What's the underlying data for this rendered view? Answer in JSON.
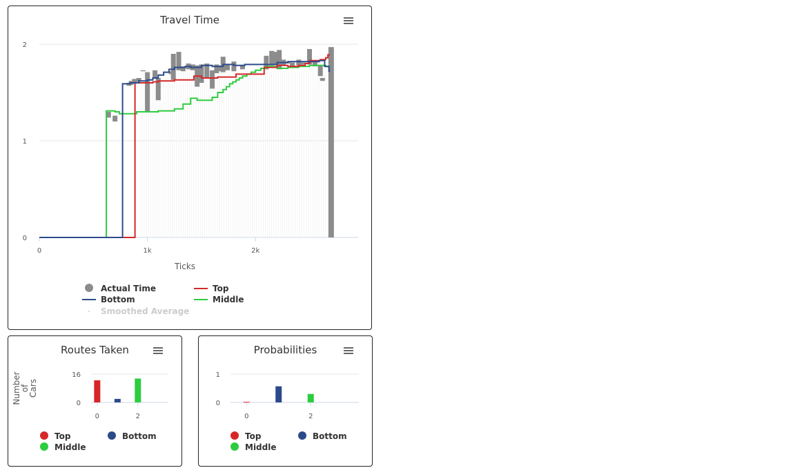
{
  "colors": {
    "top": "#d62728",
    "bottom": "#2c4a8a",
    "middle": "#2ecc40",
    "actual": "#8c8c8c",
    "smoothed": "#cccccc",
    "grid": "#e6e6e6",
    "axis": "#ccd6eb"
  },
  "travel": {
    "title": "Travel Time",
    "menu_icon": "hamburger-menu-icon"
  },
  "routes": {
    "title": "Routes Taken",
    "menu_icon": "hamburger-menu-icon"
  },
  "probs": {
    "title": "Probabilities",
    "menu_icon": "hamburger-menu-icon"
  },
  "chart_data": [
    {
      "type": "line",
      "title": "Travel Time",
      "xlabel": "Ticks",
      "ylabel": "",
      "xlim": [
        0,
        2950
      ],
      "ylim": [
        0,
        2
      ],
      "x_ticks": [
        {
          "value": 0,
          "label": "0"
        },
        {
          "value": 1000,
          "label": "1k"
        },
        {
          "value": 2000,
          "label": "2k"
        }
      ],
      "y_ticks": [
        {
          "value": 0,
          "label": "0"
        },
        {
          "value": 1,
          "label": "1"
        },
        {
          "value": 2,
          "label": "2"
        }
      ],
      "grid": true,
      "legend": {
        "placement": "bottom",
        "items": [
          {
            "name": "Actual Time",
            "symbol": "circle",
            "color_key": "actual",
            "hidden": false
          },
          {
            "name": "Top",
            "symbol": "line",
            "color_key": "top",
            "hidden": false
          },
          {
            "name": "Bottom",
            "symbol": "line",
            "color_key": "bottom",
            "hidden": false
          },
          {
            "name": "Middle",
            "symbol": "line",
            "color_key": "middle",
            "hidden": false
          },
          {
            "name": "Smoothed Average",
            "symbol": "dot",
            "color_key": "smoothed",
            "hidden": true
          }
        ]
      },
      "series": [
        {
          "name": "Top",
          "color_key": "top",
          "step": true,
          "points": [
            [
              0,
              0
            ],
            [
              885,
              0
            ],
            [
              885,
              1.6
            ],
            [
              1050,
              1.61
            ],
            [
              1100,
              1.62
            ],
            [
              1250,
              1.63
            ],
            [
              1430,
              1.67
            ],
            [
              1500,
              1.65
            ],
            [
              1650,
              1.66
            ],
            [
              1820,
              1.69
            ],
            [
              2080,
              1.76
            ],
            [
              2200,
              1.78
            ],
            [
              2300,
              1.77
            ],
            [
              2400,
              1.78
            ],
            [
              2460,
              1.8
            ],
            [
              2500,
              1.83
            ],
            [
              2600,
              1.84
            ],
            [
              2650,
              1.86
            ],
            [
              2670,
              1.89
            ],
            [
              2690,
              1.89
            ]
          ]
        },
        {
          "name": "Bottom",
          "color_key": "bottom",
          "step": true,
          "points": [
            [
              0,
              0
            ],
            [
              770,
              0
            ],
            [
              770,
              1.59
            ],
            [
              840,
              1.6
            ],
            [
              920,
              1.62
            ],
            [
              1000,
              1.63
            ],
            [
              1050,
              1.65
            ],
            [
              1100,
              1.68
            ],
            [
              1150,
              1.71
            ],
            [
              1200,
              1.74
            ],
            [
              1250,
              1.76
            ],
            [
              1350,
              1.77
            ],
            [
              1400,
              1.76
            ],
            [
              1500,
              1.78
            ],
            [
              1600,
              1.77
            ],
            [
              1700,
              1.79
            ],
            [
              1800,
              1.78
            ],
            [
              1900,
              1.79
            ],
            [
              2000,
              1.79
            ],
            [
              2200,
              1.81
            ],
            [
              2300,
              1.82
            ],
            [
              2400,
              1.82
            ],
            [
              2500,
              1.82
            ],
            [
              2590,
              1.83
            ],
            [
              2640,
              1.77
            ],
            [
              2680,
              1.72
            ],
            [
              2690,
              1.72
            ]
          ]
        },
        {
          "name": "Middle",
          "color_key": "middle",
          "step": true,
          "points": [
            [
              0,
              0
            ],
            [
              620,
              0
            ],
            [
              620,
              1.31
            ],
            [
              700,
              1.3
            ],
            [
              740,
              1.28
            ],
            [
              900,
              1.3
            ],
            [
              1100,
              1.31
            ],
            [
              1250,
              1.33
            ],
            [
              1330,
              1.38
            ],
            [
              1400,
              1.44
            ],
            [
              1460,
              1.42
            ],
            [
              1600,
              1.45
            ],
            [
              1650,
              1.5
            ],
            [
              1700,
              1.53
            ],
            [
              1730,
              1.56
            ],
            [
              1760,
              1.59
            ],
            [
              1790,
              1.61
            ],
            [
              1820,
              1.63
            ],
            [
              1850,
              1.65
            ],
            [
              1880,
              1.67
            ],
            [
              1920,
              1.69
            ],
            [
              1960,
              1.71
            ],
            [
              2000,
              1.73
            ],
            [
              2050,
              1.75
            ],
            [
              2100,
              1.77
            ],
            [
              2200,
              1.75
            ],
            [
              2300,
              1.76
            ],
            [
              2400,
              1.77
            ],
            [
              2500,
              1.78
            ],
            [
              2600,
              1.78
            ],
            [
              2650,
              1.77
            ],
            [
              2690,
              1.77
            ]
          ]
        }
      ],
      "actual_time_bars": [
        [
          640,
          1.3,
          1.24
        ],
        [
          700,
          1.26,
          1.2
        ],
        [
          830,
          1.6,
          1.57
        ],
        [
          850,
          1.62,
          1.58
        ],
        [
          880,
          1.64,
          1.6
        ],
        [
          920,
          1.65,
          1.61
        ],
        [
          960,
          1.73,
          1.72
        ],
        [
          1000,
          1.71,
          1.3
        ],
        [
          1070,
          1.73,
          1.65
        ],
        [
          1100,
          1.65,
          1.42
        ],
        [
          1220,
          1.72,
          1.69
        ],
        [
          1240,
          1.9,
          1.63
        ],
        [
          1290,
          1.92,
          1.73
        ],
        [
          1330,
          1.77,
          1.72
        ],
        [
          1380,
          1.8,
          1.74
        ],
        [
          1420,
          1.79,
          1.73
        ],
        [
          1460,
          1.78,
          1.56
        ],
        [
          1500,
          1.79,
          1.6
        ],
        [
          1550,
          1.8,
          1.65
        ],
        [
          1600,
          1.73,
          1.54
        ],
        [
          1640,
          1.79,
          1.7
        ],
        [
          1660,
          1.78,
          1.72
        ],
        [
          1700,
          1.87,
          1.71
        ],
        [
          1740,
          1.79,
          1.73
        ],
        [
          1800,
          1.82,
          1.72
        ],
        [
          1880,
          1.78,
          1.74
        ],
        [
          2100,
          1.88,
          1.74
        ],
        [
          2150,
          1.93,
          1.78
        ],
        [
          2180,
          1.92,
          1.79
        ],
        [
          2220,
          1.94,
          1.74
        ],
        [
          2260,
          1.84,
          1.78
        ],
        [
          2300,
          1.82,
          1.8
        ],
        [
          2340,
          1.81,
          1.77
        ],
        [
          2400,
          1.84,
          1.78
        ],
        [
          2440,
          1.81,
          1.79
        ],
        [
          2500,
          1.95,
          1.79
        ],
        [
          2550,
          1.82,
          1.77
        ],
        [
          2600,
          1.78,
          1.67
        ],
        [
          2620,
          1.65,
          1.62
        ],
        [
          2700,
          1.97,
          0
        ]
      ]
    },
    {
      "type": "bar",
      "title": "Routes Taken",
      "xlabel": "",
      "ylabel": "Number of Cars",
      "xlim": [
        -0.3,
        3.5
      ],
      "ylim": [
        0,
        16
      ],
      "x_ticks": [
        {
          "value": 0,
          "label": "0"
        },
        {
          "value": 2,
          "label": "2"
        }
      ],
      "y_ticks": [
        {
          "value": 0,
          "label": "0"
        },
        {
          "value": 16,
          "label": "16"
        }
      ],
      "series": [
        {
          "name": "Top",
          "color_key": "top",
          "x": 0,
          "value": 12.5
        },
        {
          "name": "Bottom",
          "color_key": "bottom",
          "x": 1,
          "value": 2
        },
        {
          "name": "Middle",
          "color_key": "middle",
          "x": 2,
          "value": 13.5
        }
      ],
      "legend": {
        "placement": "bottom",
        "items": [
          "Top",
          "Bottom",
          "Middle"
        ]
      }
    },
    {
      "type": "bar",
      "title": "Probabilities",
      "xlabel": "",
      "ylabel": "",
      "xlim": [
        -0.5,
        3.5
      ],
      "ylim": [
        0,
        1
      ],
      "x_ticks": [
        {
          "value": 0,
          "label": "0"
        },
        {
          "value": 2,
          "label": "2"
        }
      ],
      "y_ticks": [
        {
          "value": 0,
          "label": "0"
        },
        {
          "value": 1,
          "label": "1"
        }
      ],
      "series": [
        {
          "name": "Top",
          "color_key": "top",
          "x": 0,
          "value": 0.02
        },
        {
          "name": "Bottom",
          "color_key": "bottom",
          "x": 1,
          "value": 0.57
        },
        {
          "name": "Middle",
          "color_key": "middle",
          "x": 2,
          "value": 0.3
        }
      ],
      "legend": {
        "placement": "bottom",
        "items": [
          "Top",
          "Bottom",
          "Middle"
        ]
      }
    }
  ]
}
